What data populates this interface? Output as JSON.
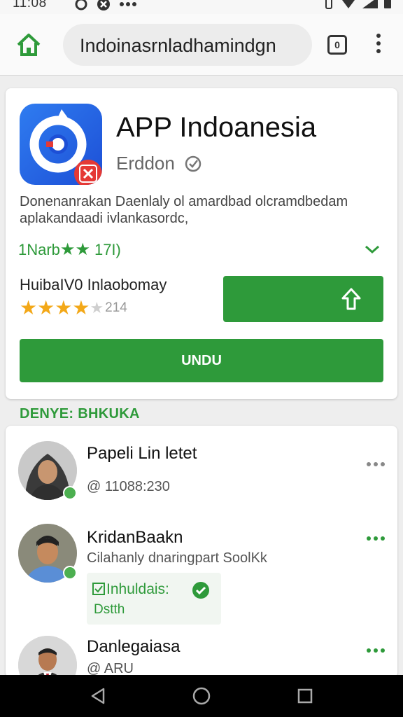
{
  "status_bar": {
    "time": "11:08",
    "left_icons": [
      "sync-icon",
      "x-icon",
      "more-icon"
    ],
    "right_icons": [
      "vibrate-icon",
      "wifi-icon",
      "signal-icon",
      "battery-icon"
    ]
  },
  "browser": {
    "url": "Indoinasrnladhamindgn",
    "tab_count": "0"
  },
  "app": {
    "title": "APP Indoanesia",
    "developer": "Erddon",
    "description": "Donenanrakan Daenlaly ol amardbad olcramdbedam aplakandaadi ivlankasordc,",
    "rating_text": "1Narb",
    "rating_count": "17I)",
    "review_label": "HuibaIV0 Inlaobomay",
    "stars_count": "214",
    "install_label": "UNDU",
    "accent_color": "#2e9a3a",
    "star_rating": 4
  },
  "section": {
    "label": "DENYE: BHKUKA"
  },
  "people": [
    {
      "name": "Papeli Lin letet",
      "sub": "@ 11088:230"
    },
    {
      "name": "KridanBaakn",
      "sub": "Cilahanly dnaringpart SoolKk",
      "chip_label": "Inhuldais:",
      "chip_sub": "Dstth"
    },
    {
      "name": "Danlegaiasa",
      "sub": "@ ARU"
    }
  ]
}
